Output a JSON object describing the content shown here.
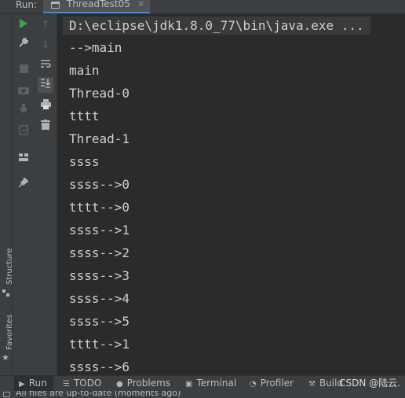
{
  "run_panel": {
    "label": "Run:",
    "tab_title": "ThreadTest05",
    "tab_close": "×"
  },
  "left_strip": {
    "structure": "Structure",
    "favorites": "Favorites"
  },
  "console": {
    "command": "D:\\eclipse\\jdk1.8.0_77\\bin\\java.exe ...",
    "lines": [
      "-->main",
      "main",
      "Thread-0",
      "tttt",
      "Thread-1",
      "ssss",
      "ssss-->0",
      "tttt-->0",
      "ssss-->1",
      "ssss-->2",
      "ssss-->3",
      "ssss-->4",
      "ssss-->5",
      "tttt-->1",
      "ssss-->6"
    ]
  },
  "bottom_tabs": [
    {
      "label": "Run",
      "icon": "run-icon"
    },
    {
      "label": "TODO",
      "icon": "todo-icon"
    },
    {
      "label": "Problems",
      "icon": "problems-icon"
    },
    {
      "label": "Terminal",
      "icon": "terminal-icon"
    },
    {
      "label": "Profiler",
      "icon": "profiler-icon"
    },
    {
      "label": "Build",
      "icon": "build-icon"
    }
  ],
  "watermark": "CSDN @陆云.",
  "status": "All files are up-to-date (moments ago)",
  "colors": {
    "background": "#2b2b2b",
    "panel": "#3c3f41",
    "run_green": "#499c54",
    "accent": "#4a88c7"
  }
}
